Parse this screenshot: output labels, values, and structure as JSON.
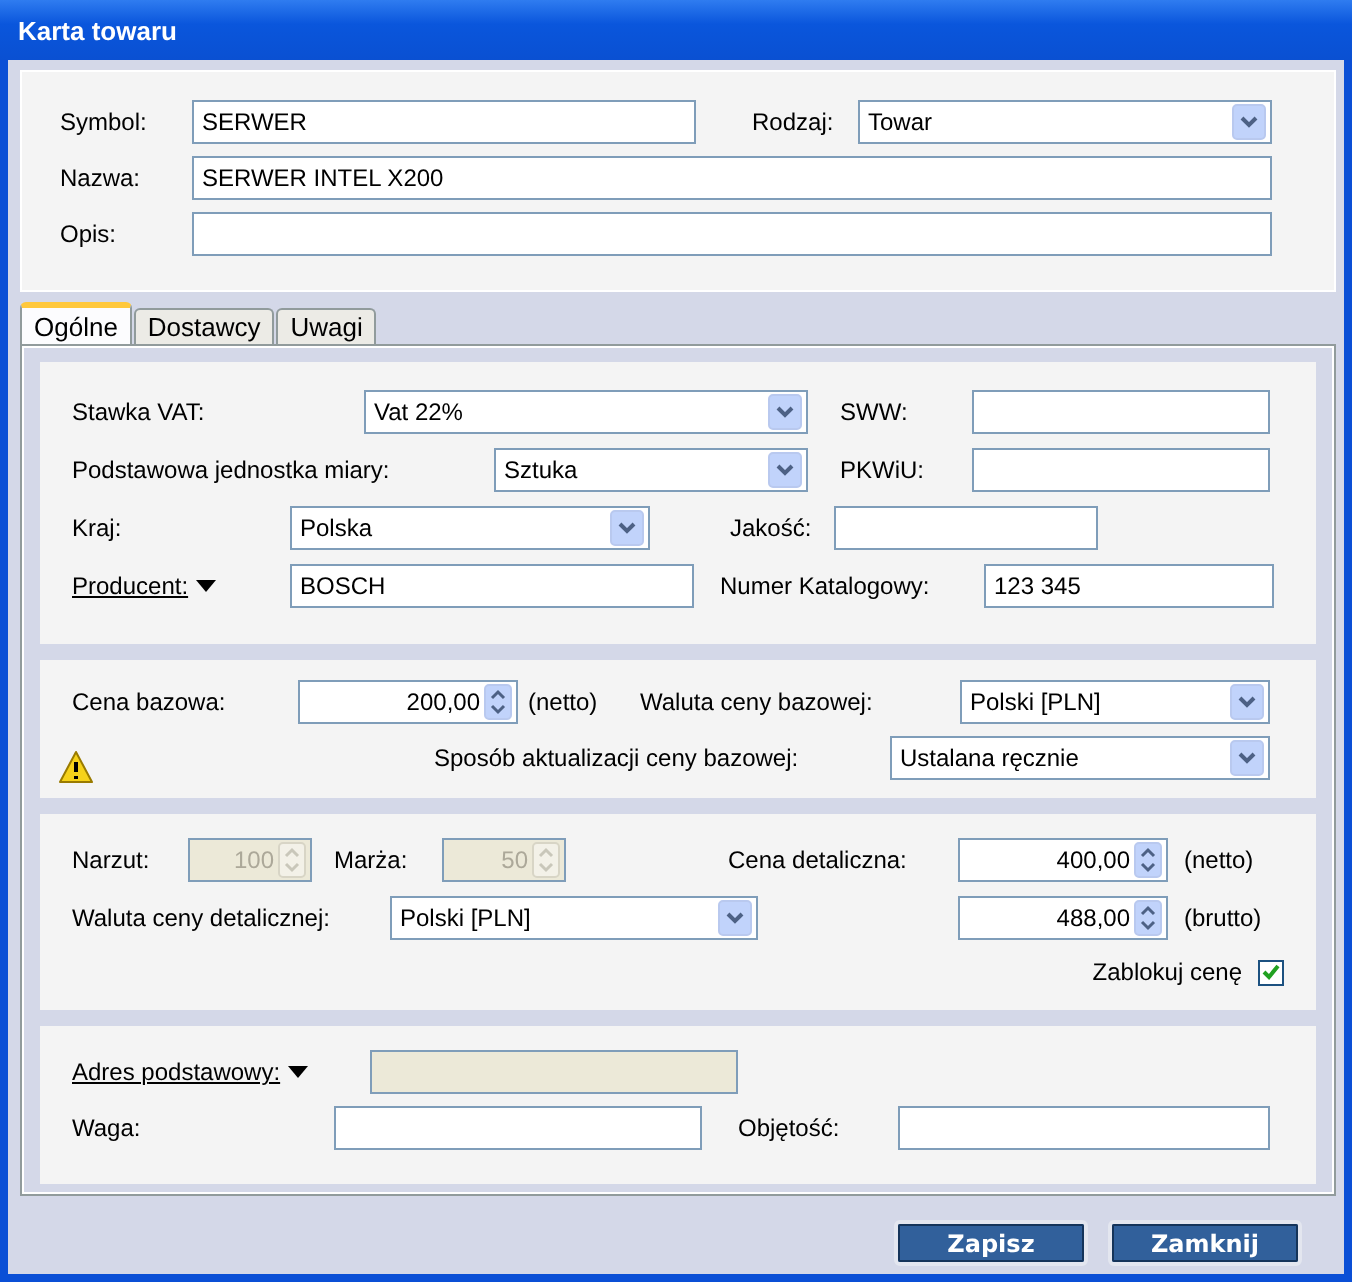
{
  "window": {
    "title": "Karta towaru"
  },
  "header": {
    "symbol": {
      "label": "Symbol:",
      "value": "SERWER"
    },
    "type": {
      "label": "Rodzaj:",
      "value": "Towar"
    },
    "name": {
      "label": "Nazwa:",
      "value": "SERWER INTEL X200"
    },
    "description": {
      "label": "Opis:"
    }
  },
  "tabs": [
    {
      "label": "Ogólne",
      "selected": true
    },
    {
      "label": "Dostawcy",
      "selected": false
    },
    {
      "label": "Uwagi",
      "selected": false
    }
  ],
  "general": {
    "vat": {
      "label": "Stawka VAT:",
      "value": "Vat 22%"
    },
    "sww": {
      "label": "SWW:"
    },
    "unit": {
      "label": "Podstawowa jednostka miary:",
      "value": "Sztuka"
    },
    "pkwiu": {
      "label": "PKWiU:"
    },
    "country": {
      "label": "Kraj:",
      "value": "Polska"
    },
    "quality": {
      "label": "Jakość:"
    },
    "producer": {
      "label": "Producent:",
      "value": "BOSCH"
    },
    "catalog_number": {
      "label": "Numer Katalogowy:",
      "value": "123 345"
    }
  },
  "base_price": {
    "price": {
      "label": "Cena bazowa:",
      "value": "200,00",
      "unit": "(netto)"
    },
    "currency": {
      "label": "Waluta ceny bazowej:",
      "value": "Polski [PLN]"
    },
    "update_method": {
      "label": "Sposób aktualizacji ceny bazowej:",
      "value": "Ustalana ręcznie"
    }
  },
  "retail": {
    "markup": {
      "label": "Narzut:",
      "value": "100",
      "disabled": true
    },
    "margin": {
      "label": "Marża:",
      "value": "50",
      "disabled": true
    },
    "price_net": {
      "label": "Cena detaliczna:",
      "value": "400,00",
      "unit": "(netto)"
    },
    "currency": {
      "label": "Waluta ceny detalicznej:",
      "value": "Polski [PLN]"
    },
    "price_gross": {
      "value": "488,00",
      "unit": "(brutto)"
    },
    "lock": {
      "label": "Zablokuj cenę",
      "checked": true
    }
  },
  "address": {
    "base_address": {
      "label": "Adres podstawowy:",
      "disabled": true
    },
    "weight": {
      "label": "Waga:"
    },
    "volume": {
      "label": "Objętość:"
    }
  },
  "buttons": [
    {
      "label": "Zapisz"
    },
    {
      "label": "Zamknij"
    }
  ]
}
